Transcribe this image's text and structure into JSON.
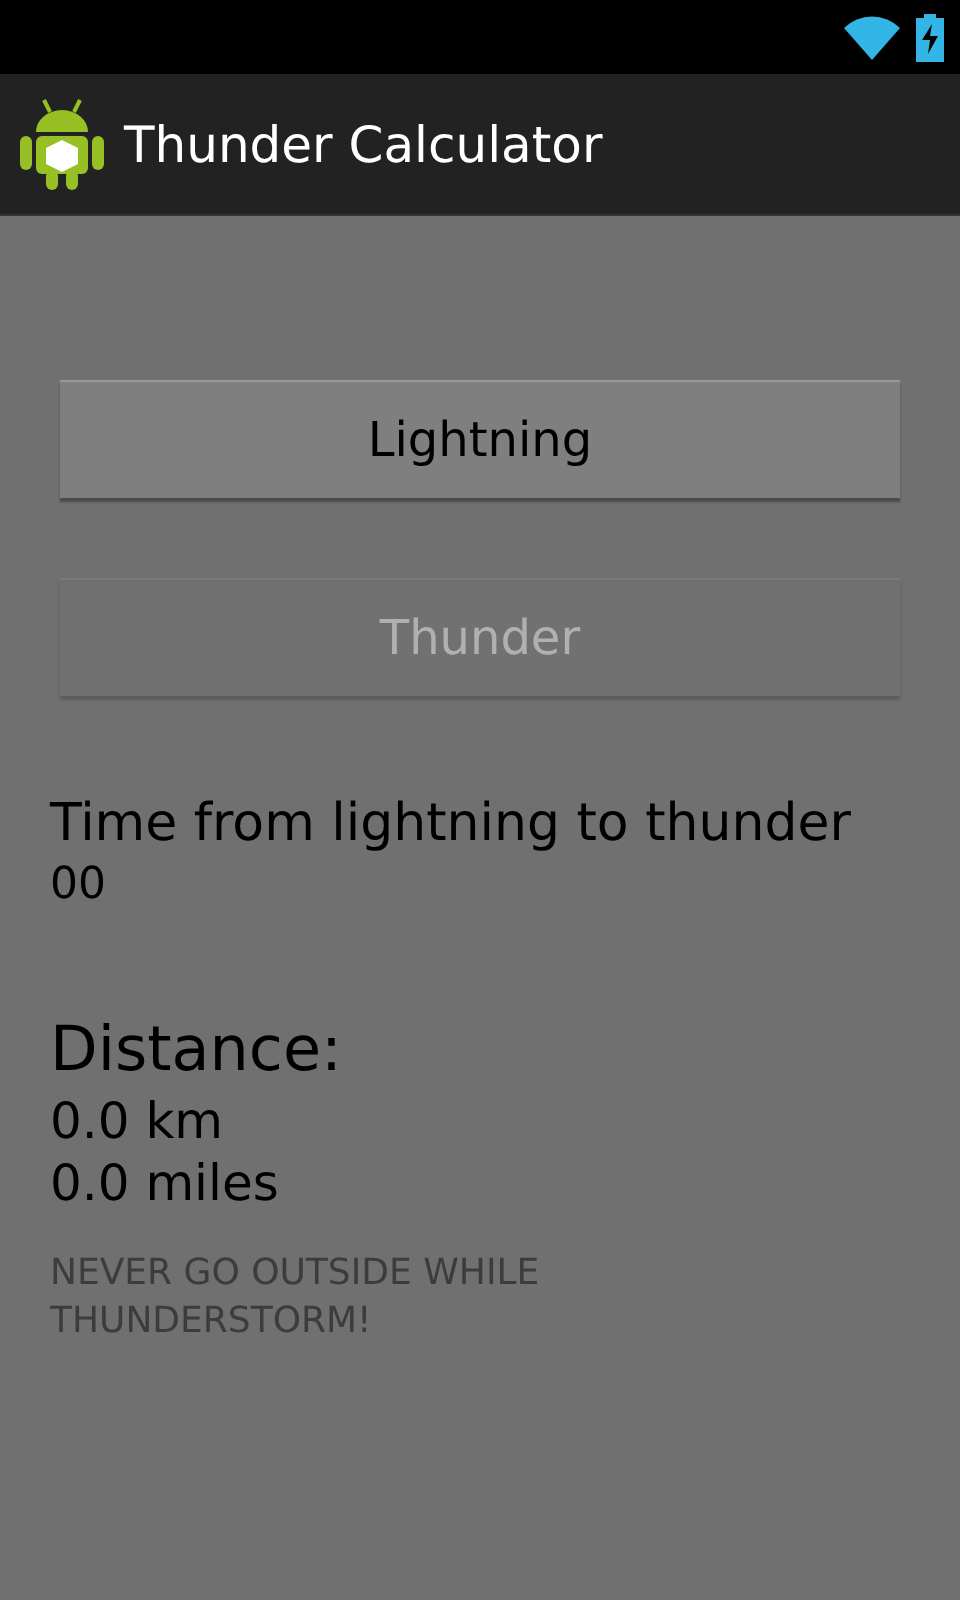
{
  "app_bar": {
    "title": "Thunder Calculator"
  },
  "buttons": [
    {
      "label": "Lightning",
      "disabled": false
    },
    {
      "label": "Thunder",
      "disabled": true
    }
  ],
  "time": {
    "label": "Time from lightning to thunder",
    "value": "00"
  },
  "distance": {
    "label": "Distance:",
    "km": "0.0 km",
    "miles": "0.0 miles"
  },
  "warning": "NEVER GO OUTSIDE WHILE THUNDERSTORM!"
}
